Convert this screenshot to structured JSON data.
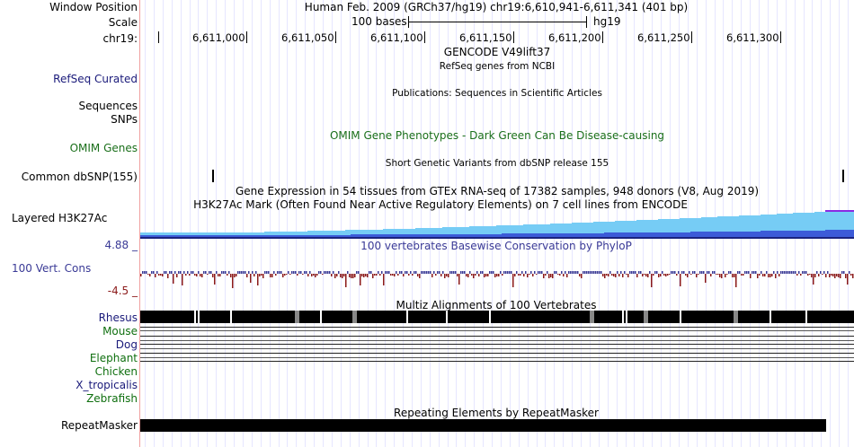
{
  "header": {
    "window_position_label": "Window Position",
    "scale_label": "Scale",
    "chrom_label": "chr19:",
    "title": "Human Feb. 2009 (GRCh37/hg19)   chr19:6,610,941-6,611,341 (401 bp)",
    "scale_text": "100 bases",
    "assembly": "hg19",
    "ticks": [
      "6,611,000",
      "6,611,050",
      "6,611,100",
      "6,611,150",
      "6,611,200",
      "6,611,250",
      "6,611,300"
    ]
  },
  "tracks": {
    "gencode_title": "GENCODE V49lift37",
    "refseq_title": "RefSeq genes from NCBI",
    "refseq_label": "RefSeq Curated",
    "pubs_title": "Publications: Sequences in Scientific Articles",
    "sequences_label": "Sequences",
    "snps_label": "SNPs",
    "omim_title": "OMIM Gene Phenotypes - Dark Green Can Be Disease-causing",
    "omim_label": "OMIM Genes",
    "dbsnp_title": "Short Genetic Variants from dbSNP release 155",
    "dbsnp_label": "Common dbSNP(155)",
    "gtex_title": "Gene Expression in 54 tissues from GTEx RNA-seq of 17382 samples, 948 donors (V8, Aug 2019)",
    "h3k27ac_title": "H3K27Ac Mark (Often Found Near Active Regulatory Elements) on 7 cell lines from ENCODE",
    "h3k27ac_label": "Layered H3K27Ac",
    "phylop_title": "100 vertebrates Basewise Conservation by PhyloP",
    "phylop_label": "100 Vert. Cons",
    "phylop_max": "4.88 _",
    "phylop_min": "-4.5 _",
    "multiz_title": "Multiz Alignments of 100 Vertebrates",
    "species": [
      "Rhesus",
      "Mouse",
      "Dog",
      "Elephant",
      "Chicken",
      "X_tropicalis",
      "Zebrafish"
    ],
    "repeat_title": "Repeating Elements by RepeatMasker",
    "repeat_label": "RepeatMasker"
  },
  "colors": {
    "omim": "#1a6f1a",
    "phylop": "#3a3a96",
    "species": "#0f6f0f",
    "refseq_label": "#1a1a7a",
    "h3k27ac_light": "#76ccf5",
    "h3k27ac_dark": "#3c5bd8"
  }
}
